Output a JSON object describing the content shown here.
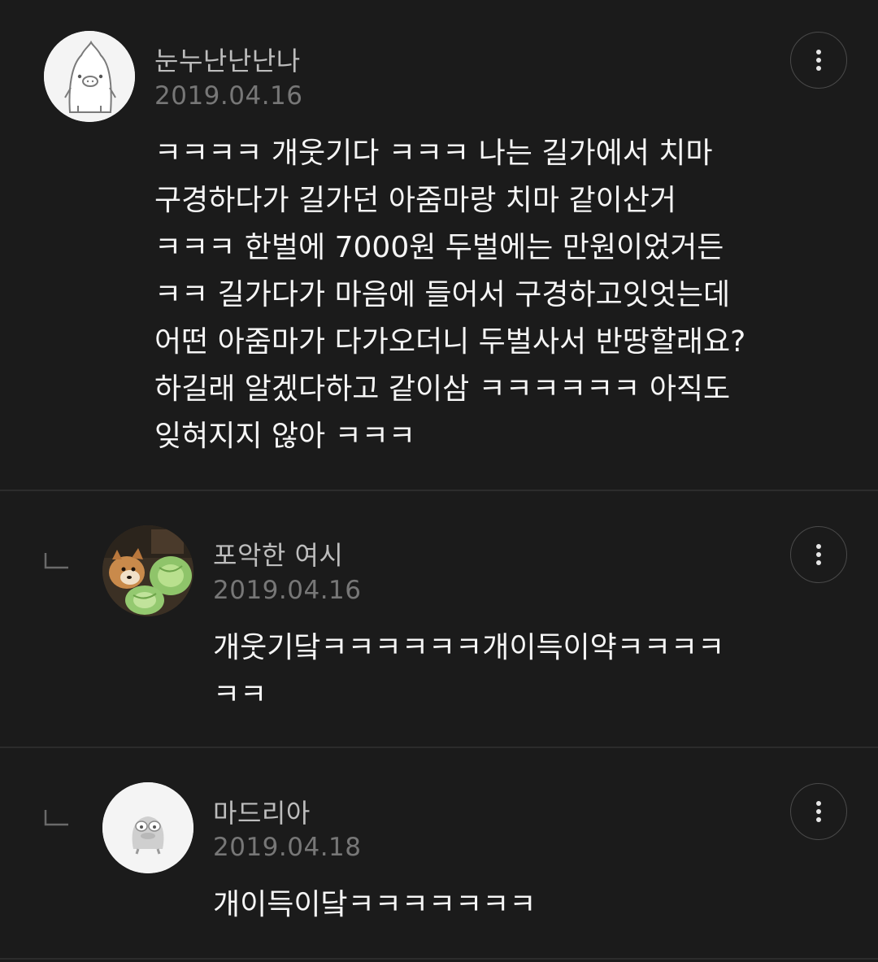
{
  "comments": [
    {
      "username": "눈누난난난나",
      "date": "2019.04.16",
      "avatar": "penguin-character-avatar",
      "text": "ㅋㅋㅋㅋ 개웃기다 ㅋㅋㅋ 나는 길가에서 치마\n구경하다가 길가던 아줌마랑 치마 같이산거\nㅋㅋㅋ 한벌에 7000원 두벌에는 만원이었거든\nㅋㅋ 길가다가 마음에 들어서 구경하고잇엇는데\n어떤 아줌마가 다가오더니 두벌사서 반땅할래요?\n하길래 알겠다하고 같이삼 ㅋㅋㅋㅋㅋㅋ 아직도\n잊혀지지 않아 ㅋㅋㅋ"
    },
    {
      "username": "포악한 여시",
      "date": "2019.04.16",
      "avatar": "dog-with-cabbage-photo",
      "is_reply": true,
      "text": "개웃기닼ㅋㅋㅋㅋㅋㅋ개이득이약ㅋㅋㅋㅋ\nㅋㅋ"
    },
    {
      "username": "마드리아",
      "date": "2019.04.18",
      "avatar": "duck-character-avatar",
      "is_reply": true,
      "text": "개이득이닼ㅋㅋㅋㅋㅋㅋㅋ"
    }
  ],
  "icons": {
    "more": "more-vertical-icon",
    "reply": "reply-arrow-icon"
  },
  "colors": {
    "background": "#1b1b1b",
    "text": "#f5f5f5",
    "username": "#bdbdbd",
    "date": "#777777",
    "divider": "#2c2c2c"
  }
}
